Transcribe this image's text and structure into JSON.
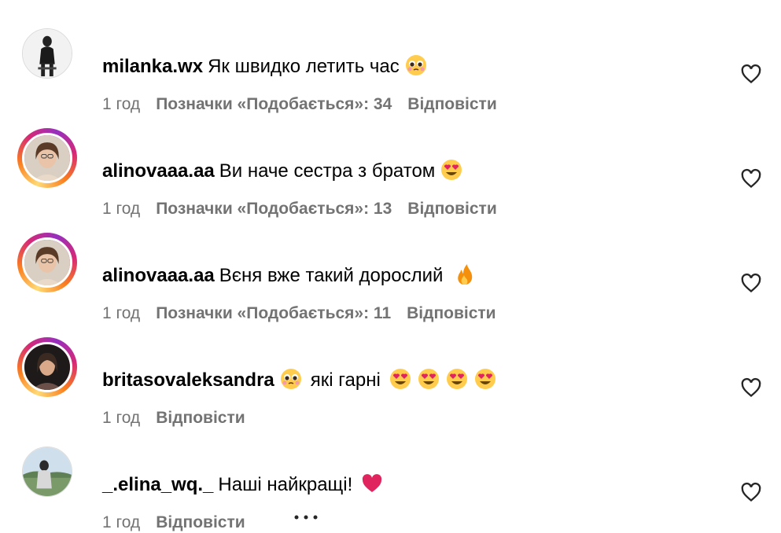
{
  "comments": [
    {
      "username": "milanka.wx",
      "text": "Як швидко летить час",
      "emojis": [
        "pleading-face-emoji"
      ],
      "time": "1 год",
      "likes": "Позначки «Подобається»: 34",
      "reply": "Відповісти",
      "story_ring": false,
      "avatar_icon": "avatar-milanka"
    },
    {
      "username": "alinovaaa.aa",
      "text": "Ви наче сестра з братом",
      "emojis": [
        "heart-eyes-emoji"
      ],
      "time": "1 год",
      "likes": "Позначки «Подобається»: 13",
      "reply": "Відповісти",
      "story_ring": true,
      "avatar_icon": "avatar-alinovaaa"
    },
    {
      "username": "alinovaaa.aa",
      "text": "Вєня вже такий дорослий ",
      "emojis": [
        "fire-emoji"
      ],
      "time": "1 год",
      "likes": "Позначки «Подобається»: 11",
      "reply": "Відповісти",
      "story_ring": true,
      "avatar_icon": "avatar-alinovaaa"
    },
    {
      "username": "britasovaleksandra",
      "text": "які гарні",
      "emojis_before": [
        "pleading-face-emoji"
      ],
      "emojis": [
        "heart-eyes-emoji",
        "heart-eyes-emoji",
        "heart-eyes-emoji",
        "heart-eyes-emoji"
      ],
      "time": "1 год",
      "likes": "",
      "reply": "Відповісти",
      "story_ring": true,
      "avatar_icon": "avatar-britasov"
    },
    {
      "username": "_.elina_wq._",
      "text": "Наші найкращі!",
      "emojis": [
        "red-heart-emoji"
      ],
      "time": "1 год",
      "likes": "",
      "reply": "Відповісти",
      "story_ring": false,
      "avatar_icon": "avatar-elina",
      "more_icon": "more-options-icon"
    }
  ],
  "icons": {
    "like": "heart-outline-icon"
  },
  "colors": {
    "secondary_text": "#737373",
    "story_ring_start": "#feda75",
    "story_ring_end": "#962fbf"
  }
}
